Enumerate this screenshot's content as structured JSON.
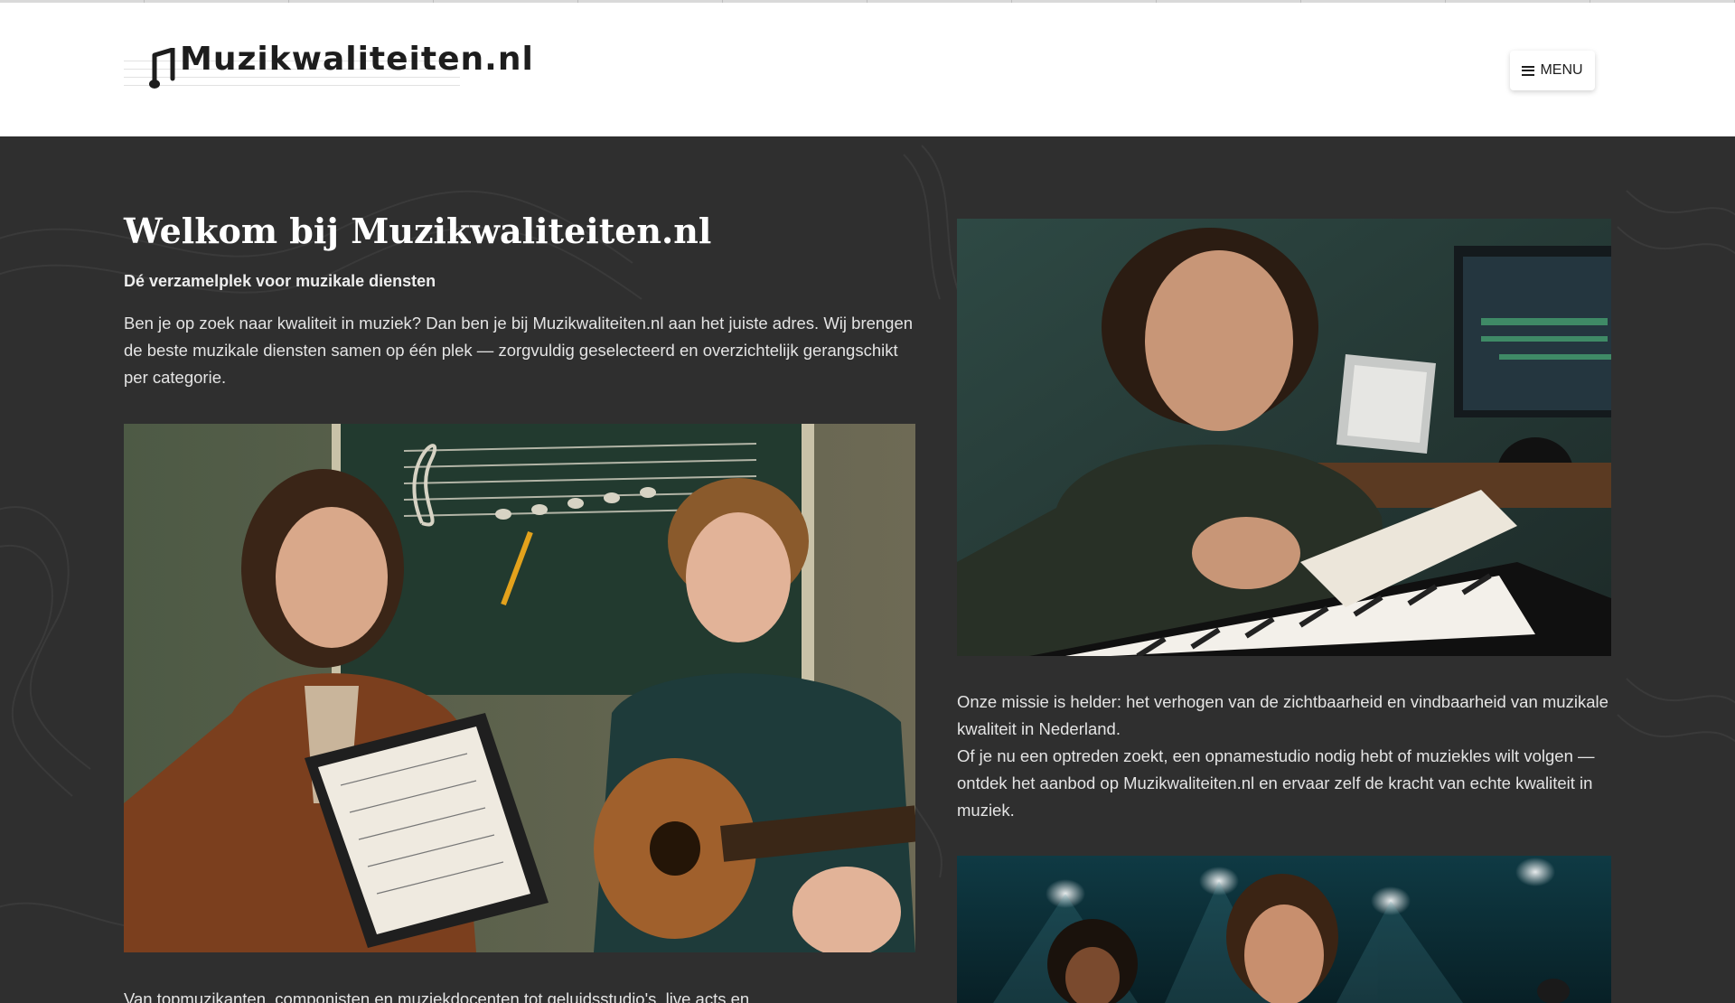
{
  "site": {
    "logo_text": "Muzikwaliteiten.nl",
    "menu_label": "MENU",
    "menu_icon": "hamburger-icon"
  },
  "hero": {
    "title": "Welkom bij Muzikwaliteiten.nl",
    "subtitle": "Dé verzamelplek voor muzikale diensten",
    "intro": "Ben je op zoek naar kwaliteit in muziek? Dan ben je bij Muzikwaliteiten.nl aan het juiste adres. Wij brengen de beste muzikale diensten samen op één plek — zorgvuldig geselecteerd en overzichtelijk gerangschikt per categorie."
  },
  "mission": {
    "line1": "Onze missie is helder: het verhogen van de zichtbaarheid en vindbaarheid van muzikale kwaliteit in Nederland.",
    "line2": "Of je nu een optreden zoekt, een opnamestudio nodig hebt of muziekles wilt volgen — ontdek het aanbod op Muzikwaliteiten.nl en ervaar zelf de kracht van echte kwaliteit in muziek."
  },
  "bottom_text": "Van topmuzikanten, componisten en muziekdocenten tot geluidsstudio's, live acts en",
  "colors": {
    "page_bg": "#2f2f2f",
    "header_bg": "#ffffff",
    "text_light": "#e4e4e4"
  }
}
